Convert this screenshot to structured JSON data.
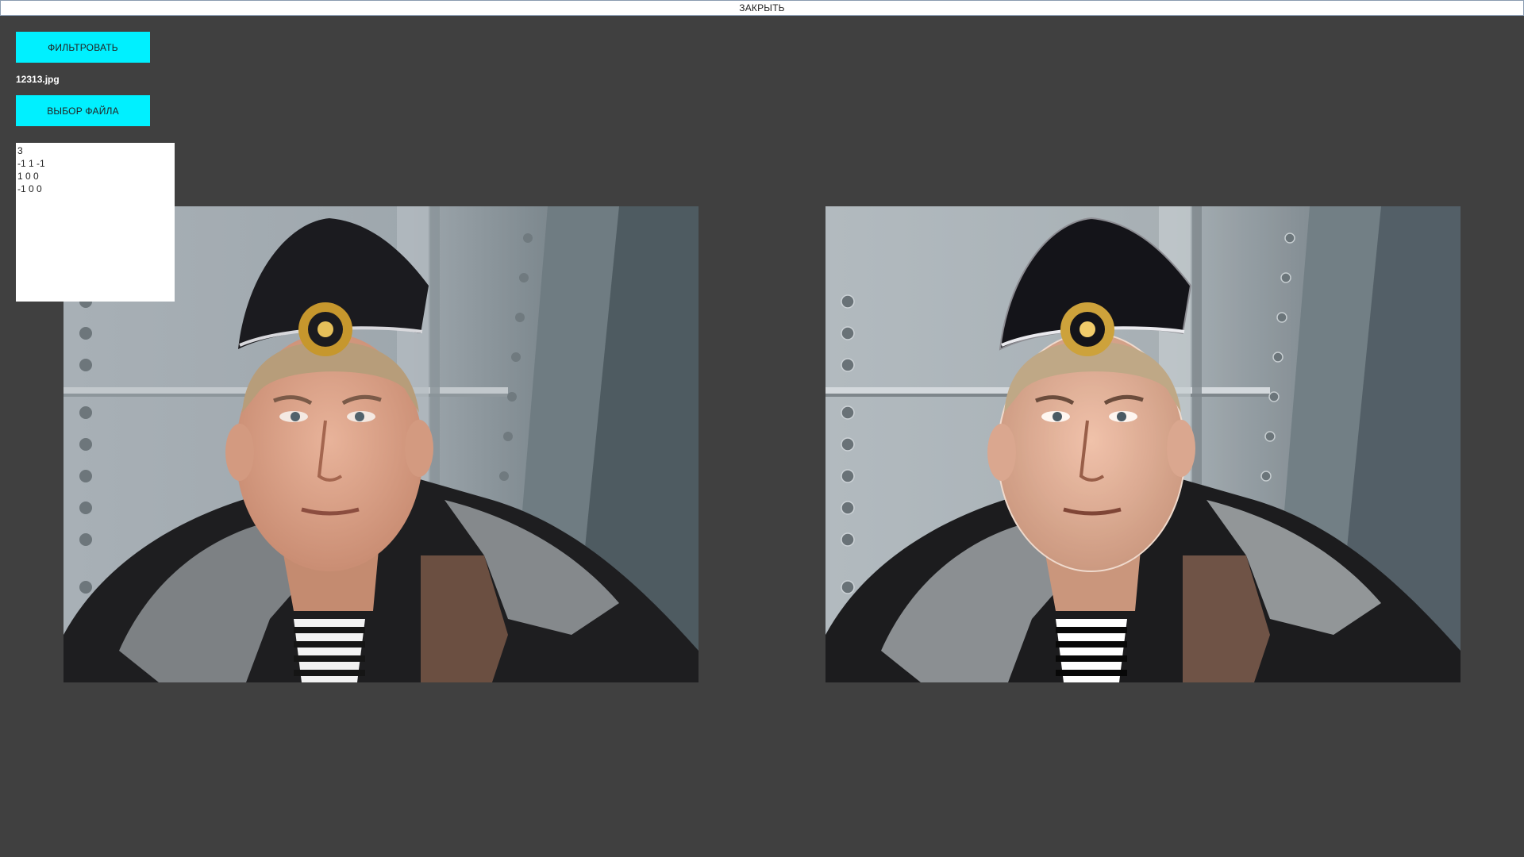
{
  "close_label": "ЗАКРЫТЬ",
  "filter_button_label": "ФИЛЬТРОВАТЬ",
  "file_name": "12313.jpg",
  "file_button_label": "ВЫБОР ФАЙЛА",
  "kernel_text": "3\n-1 1 -1\n1 0 0\n-1 0 0",
  "images": {
    "original_icon": "photo-original",
    "filtered_icon": "photo-filtered"
  },
  "colors": {
    "background": "#404040",
    "button": "#00f0ff",
    "close_bar": "#ffffff"
  }
}
